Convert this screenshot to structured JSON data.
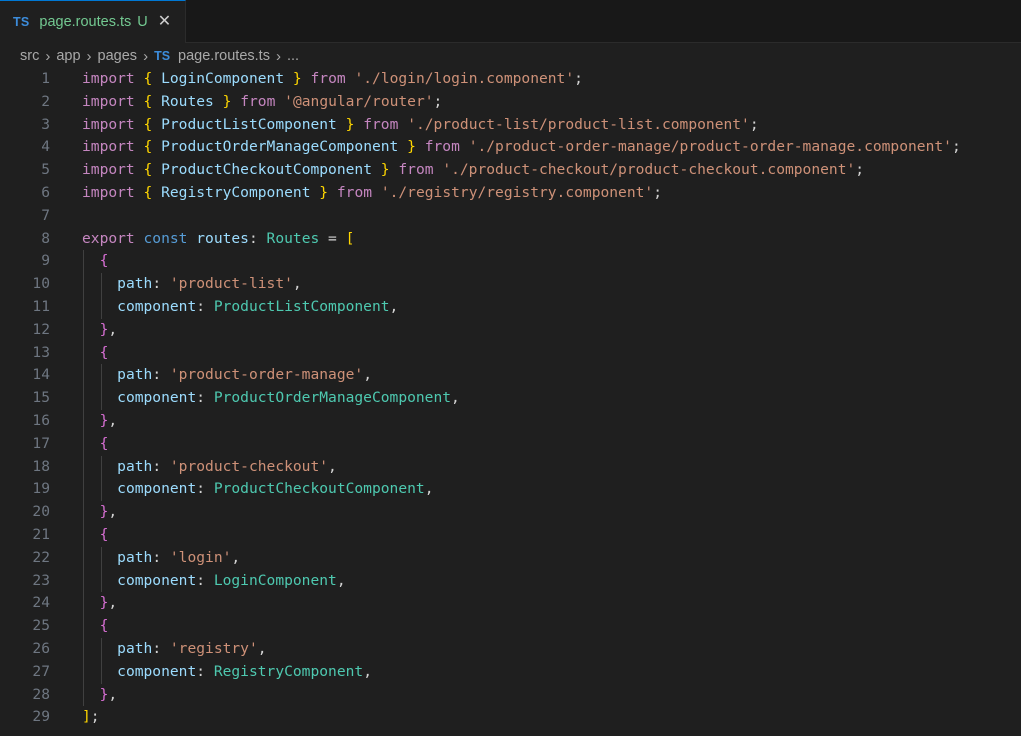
{
  "tab": {
    "badge": "TS",
    "filename": "page.routes.ts",
    "status": "U",
    "close": "✕"
  },
  "breadcrumb": {
    "parts": [
      "src",
      "app",
      "pages"
    ],
    "badge": "TS",
    "file": "page.routes.ts",
    "ellipsis": "..."
  },
  "editor": {
    "line_numbers": [
      "1",
      "2",
      "3",
      "4",
      "5",
      "6",
      "7",
      "8",
      "9",
      "10",
      "11",
      "12",
      "13",
      "14",
      "15",
      "16",
      "17",
      "18",
      "19",
      "20",
      "21",
      "22",
      "23",
      "24",
      "25",
      "26",
      "27",
      "28",
      "29"
    ],
    "lines": [
      [
        [
          "kw",
          "import"
        ],
        [
          "pn",
          " "
        ],
        [
          "br1",
          "{"
        ],
        [
          "pn",
          " "
        ],
        [
          "id",
          "LoginComponent"
        ],
        [
          "pn",
          " "
        ],
        [
          "br1",
          "}"
        ],
        [
          "pn",
          " "
        ],
        [
          "kw",
          "from"
        ],
        [
          "pn",
          " "
        ],
        [
          "str",
          "'./login/login.component'"
        ],
        [
          "pn",
          ";"
        ]
      ],
      [
        [
          "kw",
          "import"
        ],
        [
          "pn",
          " "
        ],
        [
          "br1",
          "{"
        ],
        [
          "pn",
          " "
        ],
        [
          "id",
          "Routes"
        ],
        [
          "pn",
          " "
        ],
        [
          "br1",
          "}"
        ],
        [
          "pn",
          " "
        ],
        [
          "kw",
          "from"
        ],
        [
          "pn",
          " "
        ],
        [
          "str",
          "'@angular/router'"
        ],
        [
          "pn",
          ";"
        ]
      ],
      [
        [
          "kw",
          "import"
        ],
        [
          "pn",
          " "
        ],
        [
          "br1",
          "{"
        ],
        [
          "pn",
          " "
        ],
        [
          "id",
          "ProductListComponent"
        ],
        [
          "pn",
          " "
        ],
        [
          "br1",
          "}"
        ],
        [
          "pn",
          " "
        ],
        [
          "kw",
          "from"
        ],
        [
          "pn",
          " "
        ],
        [
          "str",
          "'./product-list/product-list.component'"
        ],
        [
          "pn",
          ";"
        ]
      ],
      [
        [
          "kw",
          "import"
        ],
        [
          "pn",
          " "
        ],
        [
          "br1",
          "{"
        ],
        [
          "pn",
          " "
        ],
        [
          "id",
          "ProductOrderManageComponent"
        ],
        [
          "pn",
          " "
        ],
        [
          "br1",
          "}"
        ],
        [
          "pn",
          " "
        ],
        [
          "kw",
          "from"
        ],
        [
          "pn",
          " "
        ],
        [
          "str",
          "'./product-order-manage/product-order-manage.component'"
        ],
        [
          "pn",
          ";"
        ]
      ],
      [
        [
          "kw",
          "import"
        ],
        [
          "pn",
          " "
        ],
        [
          "br1",
          "{"
        ],
        [
          "pn",
          " "
        ],
        [
          "id",
          "ProductCheckoutComponent"
        ],
        [
          "pn",
          " "
        ],
        [
          "br1",
          "}"
        ],
        [
          "pn",
          " "
        ],
        [
          "kw",
          "from"
        ],
        [
          "pn",
          " "
        ],
        [
          "str",
          "'./product-checkout/product-checkout.component'"
        ],
        [
          "pn",
          ";"
        ]
      ],
      [
        [
          "kw",
          "import"
        ],
        [
          "pn",
          " "
        ],
        [
          "br1",
          "{"
        ],
        [
          "pn",
          " "
        ],
        [
          "id",
          "RegistryComponent"
        ],
        [
          "pn",
          " "
        ],
        [
          "br1",
          "}"
        ],
        [
          "pn",
          " "
        ],
        [
          "kw",
          "from"
        ],
        [
          "pn",
          " "
        ],
        [
          "str",
          "'./registry/registry.component'"
        ],
        [
          "pn",
          ";"
        ]
      ],
      [],
      [
        [
          "kw",
          "export"
        ],
        [
          "pn",
          " "
        ],
        [
          "kw2",
          "const"
        ],
        [
          "pn",
          " "
        ],
        [
          "id",
          "routes"
        ],
        [
          "pn",
          ": "
        ],
        [
          "ty",
          "Routes"
        ],
        [
          "pn",
          " = "
        ],
        [
          "br1",
          "["
        ]
      ],
      [
        [
          "pn",
          "  "
        ],
        [
          "br2",
          "{"
        ]
      ],
      [
        [
          "pn",
          "    "
        ],
        [
          "id",
          "path"
        ],
        [
          "pn",
          ": "
        ],
        [
          "str",
          "'product-list'"
        ],
        [
          "pn",
          ","
        ]
      ],
      [
        [
          "pn",
          "    "
        ],
        [
          "id",
          "component"
        ],
        [
          "pn",
          ": "
        ],
        [
          "ty",
          "ProductListComponent"
        ],
        [
          "pn",
          ","
        ]
      ],
      [
        [
          "pn",
          "  "
        ],
        [
          "br2",
          "}"
        ],
        [
          "pn",
          ","
        ]
      ],
      [
        [
          "pn",
          "  "
        ],
        [
          "br2",
          "{"
        ]
      ],
      [
        [
          "pn",
          "    "
        ],
        [
          "id",
          "path"
        ],
        [
          "pn",
          ": "
        ],
        [
          "str",
          "'product-order-manage'"
        ],
        [
          "pn",
          ","
        ]
      ],
      [
        [
          "pn",
          "    "
        ],
        [
          "id",
          "component"
        ],
        [
          "pn",
          ": "
        ],
        [
          "ty",
          "ProductOrderManageComponent"
        ],
        [
          "pn",
          ","
        ]
      ],
      [
        [
          "pn",
          "  "
        ],
        [
          "br2",
          "}"
        ],
        [
          "pn",
          ","
        ]
      ],
      [
        [
          "pn",
          "  "
        ],
        [
          "br2",
          "{"
        ]
      ],
      [
        [
          "pn",
          "    "
        ],
        [
          "id",
          "path"
        ],
        [
          "pn",
          ": "
        ],
        [
          "str",
          "'product-checkout'"
        ],
        [
          "pn",
          ","
        ]
      ],
      [
        [
          "pn",
          "    "
        ],
        [
          "id",
          "component"
        ],
        [
          "pn",
          ": "
        ],
        [
          "ty",
          "ProductCheckoutComponent"
        ],
        [
          "pn",
          ","
        ]
      ],
      [
        [
          "pn",
          "  "
        ],
        [
          "br2",
          "}"
        ],
        [
          "pn",
          ","
        ]
      ],
      [
        [
          "pn",
          "  "
        ],
        [
          "br2",
          "{"
        ]
      ],
      [
        [
          "pn",
          "    "
        ],
        [
          "id",
          "path"
        ],
        [
          "pn",
          ": "
        ],
        [
          "str",
          "'login'"
        ],
        [
          "pn",
          ","
        ]
      ],
      [
        [
          "pn",
          "    "
        ],
        [
          "id",
          "component"
        ],
        [
          "pn",
          ": "
        ],
        [
          "ty",
          "LoginComponent"
        ],
        [
          "pn",
          ","
        ]
      ],
      [
        [
          "pn",
          "  "
        ],
        [
          "br2",
          "}"
        ],
        [
          "pn",
          ","
        ]
      ],
      [
        [
          "pn",
          "  "
        ],
        [
          "br2",
          "{"
        ]
      ],
      [
        [
          "pn",
          "    "
        ],
        [
          "id",
          "path"
        ],
        [
          "pn",
          ": "
        ],
        [
          "str",
          "'registry'"
        ],
        [
          "pn",
          ","
        ]
      ],
      [
        [
          "pn",
          "    "
        ],
        [
          "id",
          "component"
        ],
        [
          "pn",
          ": "
        ],
        [
          "ty",
          "RegistryComponent"
        ],
        [
          "pn",
          ","
        ]
      ],
      [
        [
          "pn",
          "  "
        ],
        [
          "br2",
          "}"
        ],
        [
          "pn",
          ","
        ]
      ],
      [
        [
          "br1",
          "]"
        ],
        [
          "pn",
          ";"
        ]
      ]
    ]
  }
}
